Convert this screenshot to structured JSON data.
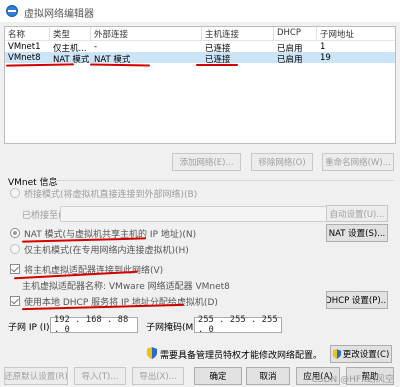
{
  "window": {
    "title": "虚拟网络编辑器"
  },
  "table": {
    "headers": [
      "名称",
      "类型",
      "外部连接",
      "主机连接",
      "DHCP",
      "子网地址"
    ],
    "rows": [
      [
        "VMnet1",
        "仅主机...",
        "-",
        "已连接",
        "已启用",
        "1"
      ],
      [
        "VMnet8",
        "NAT 模式",
        "NAT 模式",
        "已连接",
        "已启用",
        "19"
      ]
    ]
  },
  "table_buttons": {
    "add": "添加网络(E)...",
    "remove": "移除网络(O)",
    "rename": "重命名网络(W)..."
  },
  "vmnet_info": {
    "label": "VMnet 信息",
    "bridged_label": "桥接模式(将虚拟机直接连接到外部网络)(B)",
    "bridged_to_label": "已桥接至(G):",
    "bridged_to_value": "",
    "auto_settings": "自动设置(U)...",
    "nat_label": "NAT 模式(与虚拟机共享主机的 IP 地址)(N)",
    "nat_settings": "NAT 设置(S)...",
    "hostonly_label": "仅主机模式(在专用网络内连接虚拟机)(H)",
    "connect_adapter_label": "将主机虚拟适配器连接到此网络(V)",
    "adapter_name_label": "主机虚拟适配器名称: VMware 网络适配器 VMnet8",
    "dhcp_label": "使用本地 DHCP 服务将 IP 地址分配给虚拟机(D)",
    "dhcp_settings": "DHCP 设置(P)..."
  },
  "subnet": {
    "ip_label": "子网 IP (I):",
    "ip_value": "192 . 168 . 88  .  0",
    "mask_label": "子网掩码(M):",
    "mask_value": "255 . 255 . 255 . 0"
  },
  "admin_notice": "需要具备管理员特权才能修改网络配置。",
  "change_settings": "更改设置(C)",
  "bottom_buttons": {
    "restore": "还原默认设置(R)",
    "import": "导入(T)...",
    "export": "导出(X)...",
    "ok": "确定",
    "cancel": "取消",
    "apply": "应用(A)",
    "help": "帮助"
  },
  "watermark": "CSDN @HFK幻风空",
  "colors": {
    "selection": "#cce4f7",
    "annotation_red": "#d40000",
    "shield_blue": "#2a6ad3",
    "shield_yellow": "#f2c300"
  }
}
